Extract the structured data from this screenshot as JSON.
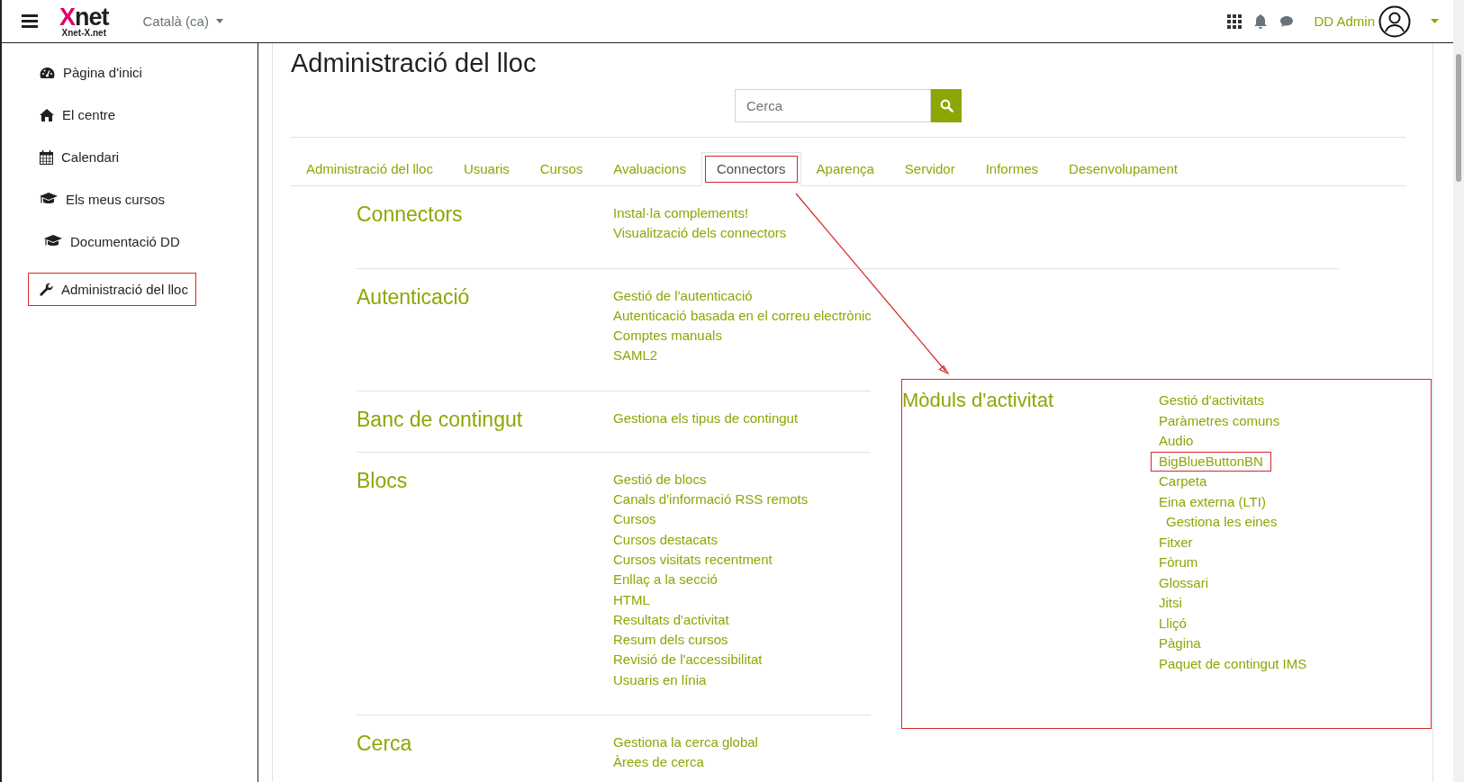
{
  "topbar": {
    "logo": "Xnet",
    "logo_subtitle": "Xnet-X.net",
    "language": "Català (ca)",
    "user": "DD Admin"
  },
  "sidebar": {
    "items": [
      {
        "label": "Pàgina d'inici",
        "highlighted": false
      },
      {
        "label": "El centre",
        "highlighted": false
      },
      {
        "label": "Calendari",
        "highlighted": false
      },
      {
        "label": "Els meus cursos",
        "highlighted": false
      },
      {
        "label": "Documentació DD",
        "highlighted": false
      },
      {
        "label": "Administració del lloc",
        "highlighted": true
      }
    ]
  },
  "page": {
    "title": "Administració del lloc",
    "search": {
      "placeholder": "Cerca"
    }
  },
  "tabs": [
    {
      "label": "Administració del lloc",
      "selected": false,
      "highlighted": false
    },
    {
      "label": "Usuaris",
      "selected": false,
      "highlighted": false
    },
    {
      "label": "Cursos",
      "selected": false,
      "highlighted": false
    },
    {
      "label": "Avaluacions",
      "selected": false,
      "highlighted": false
    },
    {
      "label": "Connectors",
      "selected": true,
      "highlighted": true
    },
    {
      "label": "Aparença",
      "selected": false,
      "highlighted": false
    },
    {
      "label": "Servidor",
      "selected": false,
      "highlighted": false
    },
    {
      "label": "Informes",
      "selected": false,
      "highlighted": false
    },
    {
      "label": "Desenvolupament",
      "selected": false,
      "highlighted": false
    }
  ],
  "sections": [
    {
      "title": "Connectors",
      "links": [
        {
          "label": "Instal·la complements!"
        },
        {
          "label": "Visualització dels connectors"
        }
      ]
    },
    {
      "title": "Autenticació",
      "links": [
        {
          "label": "Gestió de l'autenticació"
        },
        {
          "label": "Autenticació basada en el correu electrònic"
        },
        {
          "label": "Comptes manuals"
        },
        {
          "label": "SAML2"
        }
      ]
    },
    {
      "title": "Banc de contingut",
      "links": [
        {
          "label": "Gestiona els tipus de contingut"
        }
      ]
    },
    {
      "title": "Blocs",
      "links": [
        {
          "label": "Gestió de blocs"
        },
        {
          "label": "Canals d'informació RSS remots"
        },
        {
          "label": "Cursos"
        },
        {
          "label": "Cursos destacats"
        },
        {
          "label": "Cursos visitats recentment"
        },
        {
          "label": "Enllaç a la secció"
        },
        {
          "label": "HTML"
        },
        {
          "label": "Resultats d'activitat"
        },
        {
          "label": "Resum dels cursos"
        },
        {
          "label": "Revisió de l'accessibilitat"
        },
        {
          "label": "Usuaris en línia"
        }
      ]
    },
    {
      "title": "Cerca",
      "links": [
        {
          "label": "Gestiona la cerca global"
        },
        {
          "label": "Àrees de cerca"
        }
      ]
    }
  ],
  "callout": {
    "title": "Mòduls d'activitat",
    "links": [
      {
        "label": "Gestió d'activitats",
        "highlighted": false
      },
      {
        "label": "Paràmetres comuns",
        "highlighted": false
      },
      {
        "label": "Audio",
        "highlighted": false
      },
      {
        "label": "BigBlueButtonBN",
        "highlighted": true
      },
      {
        "label": "Carpeta",
        "highlighted": false
      },
      {
        "label": "Eina externa (LTI)",
        "highlighted": false,
        "children": [
          {
            "label": "Gestiona les eines",
            "highlighted": false
          }
        ]
      },
      {
        "label": "Fitxer",
        "highlighted": false
      },
      {
        "label": "Fòrum",
        "highlighted": false
      },
      {
        "label": "Glossari",
        "highlighted": false
      },
      {
        "label": "Jitsi",
        "highlighted": false
      },
      {
        "label": "Lliçó",
        "highlighted": false
      },
      {
        "label": "Pàgina",
        "highlighted": false
      },
      {
        "label": "Paquet de contingut IMS",
        "highlighted": false
      }
    ]
  }
}
